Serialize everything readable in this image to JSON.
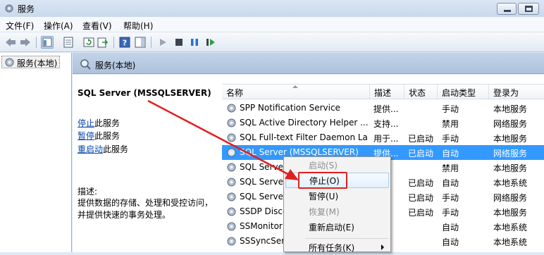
{
  "window": {
    "title": "服务"
  },
  "menu": [
    "文件(F)",
    "操作(A)",
    "查看(V)",
    "帮助(H)"
  ],
  "toolbar": {
    "icons": [
      "back-icon",
      "forward-icon",
      "show-hide-tree-icon",
      "properties-icon",
      "refresh-icon",
      "export-list-icon",
      "help-icon",
      "action-pane-icon",
      "start-service-icon",
      "stop-service-icon",
      "pause-service-icon",
      "restart-service-icon"
    ]
  },
  "tree": {
    "root_label": "服务(本地)"
  },
  "detail_header": {
    "title": "服务(本地)"
  },
  "detail": {
    "service_name": "SQL Server (MSSQLSERVER)",
    "actions": [
      {
        "link": "停止",
        "suffix": "此服务"
      },
      {
        "link": "暂停",
        "suffix": "此服务"
      },
      {
        "link": "重启动",
        "suffix": "此服务"
      }
    ],
    "description_label": "描述:",
    "description_lines": [
      "提供数据的存储、处理和受控访问，",
      "并提供快速的事务处理。"
    ]
  },
  "columns": [
    "名称",
    "描述",
    "状态",
    "启动类型",
    "登录为"
  ],
  "rows": [
    {
      "name": "SPP Notification Service",
      "desc": "提供...",
      "status": "",
      "startup": "手动",
      "logon": "本地服务"
    },
    {
      "name": "SQL Active Directory Helper ...",
      "desc": "支持...",
      "status": "",
      "startup": "禁用",
      "logon": "网络服务"
    },
    {
      "name": "SQL Full-text Filter Daemon La...",
      "desc": "用于...",
      "status": "已启动",
      "startup": "手动",
      "logon": "本地服务"
    },
    {
      "name": "SQL Server (MSSQLSERVER)",
      "desc": "提供...",
      "status": "已启动",
      "startup": "自动",
      "logon": "网络服务"
    },
    {
      "name": "SQL Server",
      "desc": "",
      "status": "",
      "startup": "禁用",
      "logon": "本地服务"
    },
    {
      "name": "SQL Server",
      "desc": "",
      "status": "已启动",
      "startup": "自动",
      "logon": "本地系统"
    },
    {
      "name": "SQL Server",
      "desc": "",
      "status": "已启动",
      "startup": "手动",
      "logon": "网络服务"
    },
    {
      "name": "SSDP Disco",
      "desc": "",
      "status": "已启动",
      "startup": "手动",
      "logon": "本地服务"
    },
    {
      "name": "SSMonitor",
      "desc": "",
      "status": "",
      "startup": "自动",
      "logon": "本地系统"
    },
    {
      "name": "SSSyncSer",
      "desc": "",
      "status": "",
      "startup": "自动",
      "logon": "本地系统"
    }
  ],
  "selected_row": 3,
  "context_menu": {
    "items": [
      "启动(S)",
      "停止(O)",
      "暂停(U)",
      "恢复(M)",
      "重新启动(E)",
      "所有任务(K)"
    ],
    "disabled": [
      true,
      false,
      false,
      true,
      false,
      false
    ],
    "highlighted_index": 1,
    "submenu_index": 5
  },
  "annotation": {
    "color": "#e02020"
  }
}
